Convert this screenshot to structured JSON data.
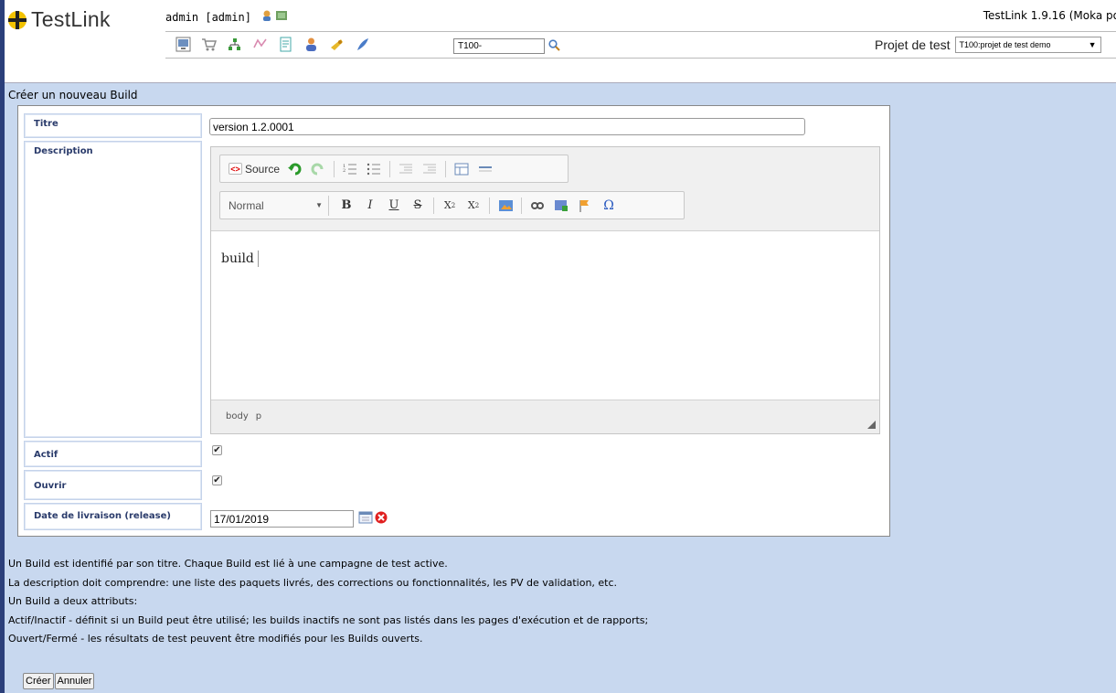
{
  "app": {
    "name": "TestLink",
    "version": "TestLink 1.9.16 (Moka po"
  },
  "user": {
    "label": "admin [admin]"
  },
  "toolbar": {
    "icons": [
      "desktop-icon",
      "cart-icon",
      "tree-icon",
      "requirements-icon",
      "document-icon",
      "user-icon",
      "bell-icon",
      "feather-icon"
    ],
    "search_value": "T100-",
    "project_label": "Projet de test",
    "project_value": "T100:projet de test demo"
  },
  "page": {
    "title": "Créer un nouveau Build"
  },
  "form": {
    "title_label": "Titre",
    "title_value": "version 1.2.0001",
    "description_label": "Description",
    "active_label": "Actif",
    "open_label": "Ouvrir",
    "release_label": "Date de livraison (release)",
    "release_value": "17/01/2019",
    "active_checked": true,
    "open_checked": true
  },
  "editor": {
    "source_label": "Source",
    "format_label": "Normal",
    "content": "build",
    "path": [
      "body",
      "p"
    ],
    "bold": "B",
    "italic": "I",
    "underline": "U",
    "strike": "S",
    "sub": "X",
    "sup": "X",
    "omega": "Ω"
  },
  "help": [
    "Un Build est identifié par son titre. Chaque Build est lié à une campagne de test active.",
    "La description doit comprendre: une liste des paquets livrés, des corrections ou fonctionnalités, les PV de validation, etc.",
    "Un Build a deux attributs:",
    "Actif/Inactif - définit si un Build peut être utilisé; les builds inactifs ne sont pas listés dans les pages d'exécution et de rapports;",
    "Ouvert/Fermé - les résultats de test peuvent être modifiés pour les Builds ouverts."
  ],
  "buttons": {
    "create": "Créer",
    "cancel": "Annuler"
  },
  "colors": {
    "main_bg": "#c8d8ef",
    "label_text": "#2a3b6b",
    "logo_yellow": "#f2c200"
  }
}
